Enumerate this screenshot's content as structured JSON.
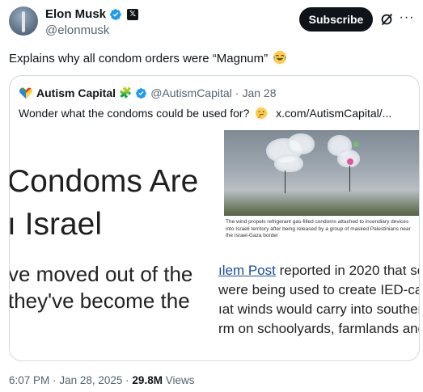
{
  "author": {
    "display_name": "Elon Musk",
    "handle": "@elonmusk",
    "verified_color": "#1d9bf0",
    "affiliate_badge": "𝕏"
  },
  "actions": {
    "subscribe_label": "Subscribe",
    "grok_icon": "grok-icon",
    "more_icon": "more-icon",
    "more_glyph": "···"
  },
  "tweet": {
    "text": "Explains why all condom orders were “Magnum”",
    "emoji": "face-with-tears-of-joy"
  },
  "quote": {
    "display_name": "Autism Capital",
    "name_emoji": "🧩",
    "handle": "@AutismCapital",
    "separator": "·",
    "date": "Jan 28",
    "text": "Wonder what the condoms could be used for?",
    "emoji": "thinking-face",
    "link": "x.com/AutismCapital/..."
  },
  "media": {
    "headline_line1": "Condoms Are",
    "headline_line2": "ı Israel",
    "photo_caption": "The wind propels refrigerant gas-filled condoms attached to incendiary devices into Israeli territory after being released by a group of masked Palestinians near the Israel-Gaza border",
    "left_line1": "ve moved out of the",
    "left_line2": "they've become the",
    "right_link": "ılem Post",
    "right_line1_rest": " reported in 2020 that sc",
    "right_line2": "were being used to create IED-carr",
    "right_line3": "ıat winds would carry into souther",
    "right_line4": "rm on schoolyards, farmlands and"
  },
  "meta": {
    "time": "6:07 PM",
    "separator": "·",
    "date": "Jan 28, 2025",
    "views_count": "29.8M",
    "views_label": "Views"
  }
}
